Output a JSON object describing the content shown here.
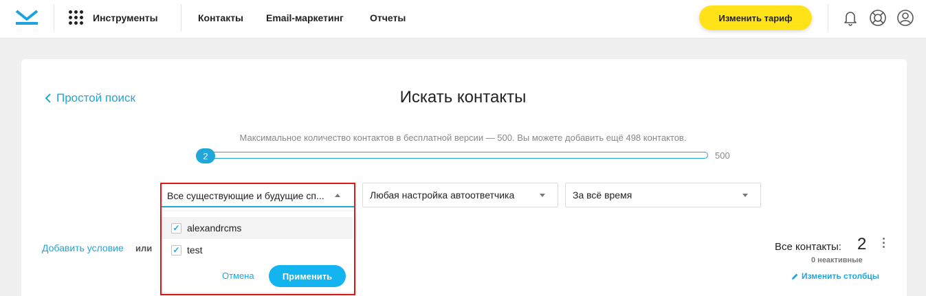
{
  "header": {
    "tools_label": "Инструменты",
    "nav": [
      "Контакты",
      "Email-маркетинг",
      "Отчеты"
    ],
    "upgrade_label": "Изменить тариф",
    "accent": "#ffe318"
  },
  "main": {
    "back_link": "Простой поиск",
    "title": "Искать контакты",
    "limit_note": "Максимальное количество контактов в бесплатной версии — 500. Вы можете добавить ещё 498 контактов.",
    "slider": {
      "value": "2",
      "max": "500"
    },
    "filters": {
      "lists": "Все существующие и будущие сп...",
      "autoresponder": "Любая настройка автоответчика",
      "period": "За всё время"
    },
    "dropdown": {
      "items": [
        {
          "label": "alexandrcms",
          "checked": true
        },
        {
          "label": "test",
          "checked": true
        }
      ],
      "cancel": "Отмена",
      "apply": "Применить"
    },
    "add_condition": "Добавить условие",
    "or": "или",
    "all_contacts_label": "Все контакты:",
    "all_contacts_count": "2",
    "inactive": "0 неактивные",
    "edit_columns": "Изменить столбцы",
    "accent": "#20a6d8"
  },
  "icons": [
    "envelope-logo-icon",
    "apps-grid-icon",
    "bell-icon",
    "help-lifebuoy-icon",
    "user-icon",
    "chevron-left-icon",
    "pencil-icon",
    "kebab-menu-icon",
    "check-icon"
  ]
}
